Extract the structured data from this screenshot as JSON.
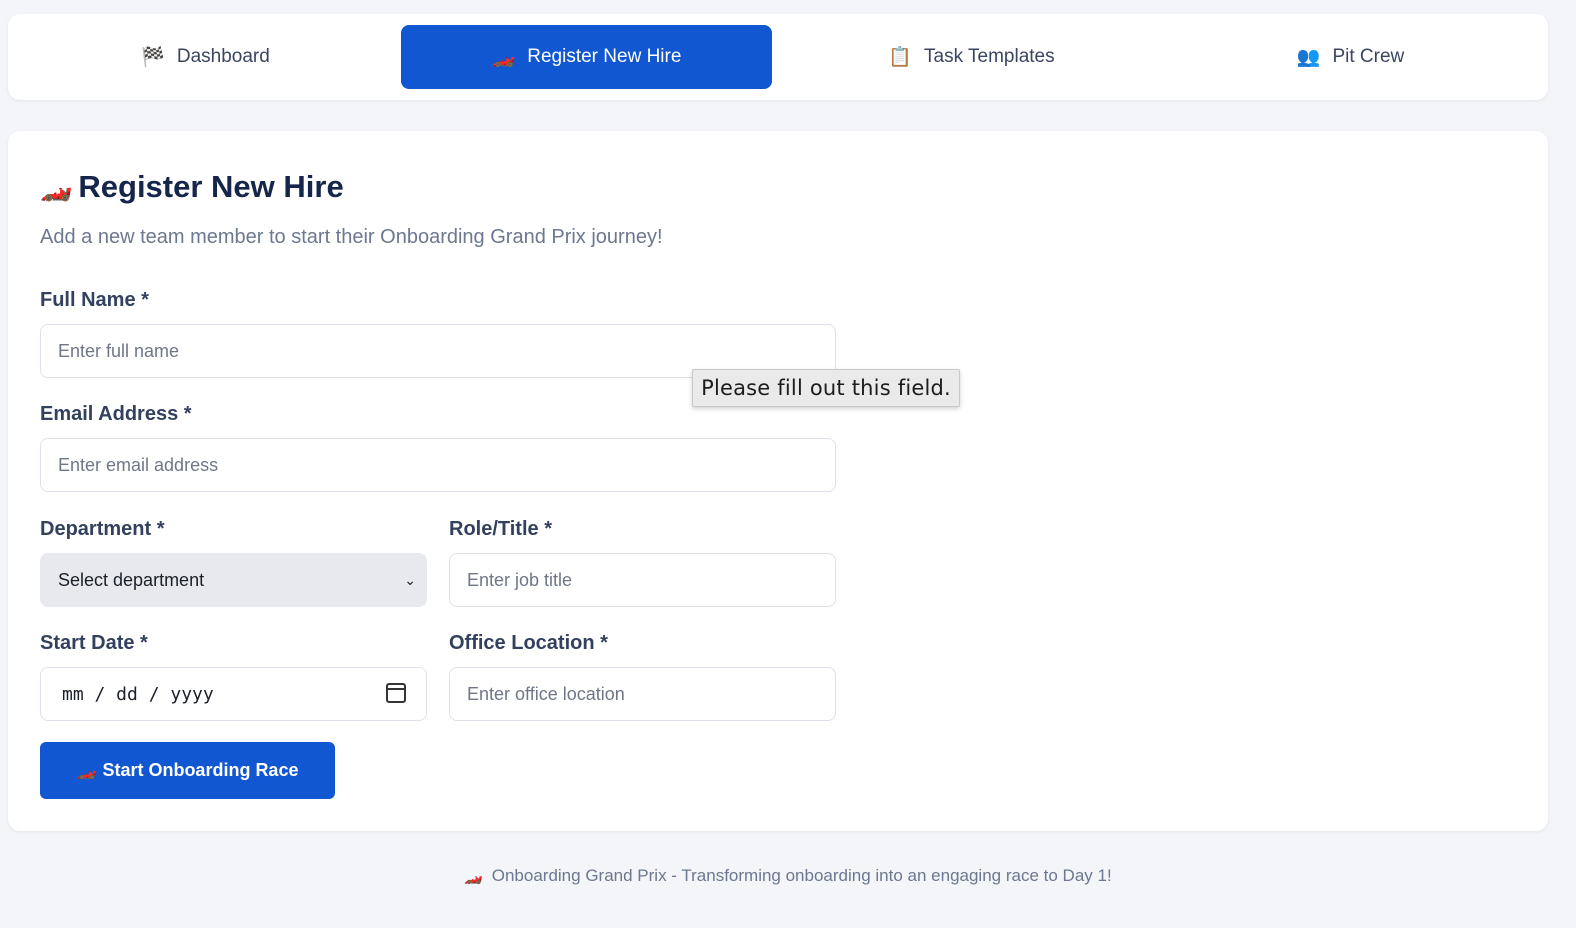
{
  "nav": {
    "tabs": [
      {
        "icon": "🏁",
        "label": "Dashboard"
      },
      {
        "icon": "🏎️",
        "label": "Register New Hire"
      },
      {
        "icon": "📋",
        "label": "Task Templates"
      },
      {
        "icon": "👥",
        "label": "Pit Crew"
      }
    ],
    "active_tab": "Register New Hire"
  },
  "page": {
    "title_icon": "🏎️",
    "title": "Register New Hire",
    "subtitle": "Add a new team member to start their Onboarding Grand Prix journey!"
  },
  "form": {
    "full_name": {
      "label": "Full Name *",
      "placeholder": "Enter full name",
      "value": ""
    },
    "email": {
      "label": "Email Address *",
      "placeholder": "Enter email address",
      "value": ""
    },
    "department": {
      "label": "Department *",
      "selected": "Select department"
    },
    "role": {
      "label": "Role/Title *",
      "placeholder": "Enter job title",
      "value": ""
    },
    "start_date": {
      "label": "Start Date *",
      "placeholder": "mm / dd / yyyy"
    },
    "office": {
      "label": "Office Location *",
      "placeholder": "Enter office location",
      "value": ""
    },
    "submit_icon": "🏎️",
    "submit_label": "Start Onboarding Race"
  },
  "validation_tooltip": "Please fill out this field.",
  "footer": {
    "icon": "🏎️",
    "text": "Onboarding Grand Prix - Transforming onboarding into an engaging race to Day 1!"
  },
  "colors": {
    "accent": "#1157d1",
    "background": "#f3f5f8",
    "title": "#16264a"
  }
}
